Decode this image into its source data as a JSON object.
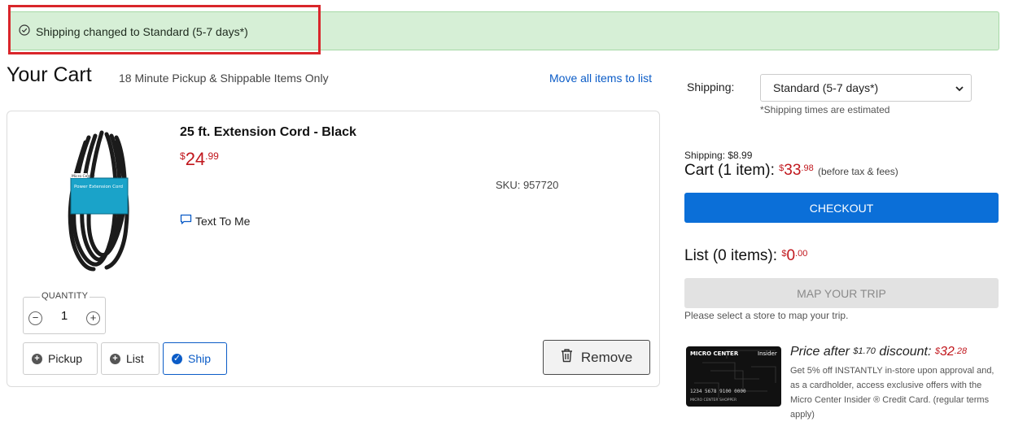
{
  "alert": {
    "message": "Shipping changed to Standard (5-7 days*)"
  },
  "header": {
    "title": "Your Cart",
    "subtitle": "18 Minute Pickup & Shippable Items Only",
    "move_all_label": "Move all items to list"
  },
  "item": {
    "name": "25 ft. Extension Cord - Black",
    "price": {
      "currency": "$",
      "dollars": "24",
      "cents": ".99"
    },
    "sku": "SKU: 957720",
    "text_to_me": "Text To Me",
    "quantity_label": "QUANTITY",
    "quantity": "1",
    "minus": "−",
    "plus": "+",
    "options": {
      "pickup": "Pickup",
      "list": "List",
      "ship": "Ship"
    },
    "remove_label": "Remove"
  },
  "shipping": {
    "label": "Shipping:",
    "selected": "Standard (5-7 days*)",
    "note": "*Shipping times are estimated"
  },
  "summary": {
    "shipping_cost": "Shipping: $8.99",
    "cart_label": "Cart (1 item):",
    "cart_currency": "$",
    "cart_dollars": "33",
    "cart_cents": ".98",
    "cart_note": "(before tax & fees)",
    "checkout_label": "CHECKOUT",
    "list_label": "List (0 items):",
    "list_currency": "$",
    "list_dollars": "0",
    "list_cents": ".00",
    "map_label": "MAP YOUR TRIP",
    "map_note": "Please select a store to map your trip."
  },
  "promo": {
    "title_prefix": "Price after",
    "discount_currency": "$",
    "discount_amount": "1.70",
    "title_mid": "discount:",
    "final_currency": "$",
    "final_dollars": "32",
    "final_cents": ".28",
    "text": "Get 5% off INSTANTLY in-store upon approval and, as a cardholder, access exclusive offers with the Micro Center Insider ® Credit Card. (regular terms apply)",
    "card_brand": "MICRO CENTER",
    "card_tag": "Insider",
    "card_number": "1234 5678 9100 0000",
    "card_holder": "MICRO CENTER SHOPPER"
  },
  "product_image_brand": "Micro Center",
  "product_image_label": "Power Extension Cord",
  "colors": {
    "accent_blue": "#0b6fd8",
    "price_red": "#c1171d",
    "alert_bg": "#d6efd6",
    "highlight_red": "#d9262b"
  },
  "icons": [
    "check-circle-icon",
    "chat-icon",
    "minus-icon",
    "plus-icon",
    "plus-circle-icon",
    "check-icon",
    "trash-icon",
    "chevron-down-icon"
  ]
}
